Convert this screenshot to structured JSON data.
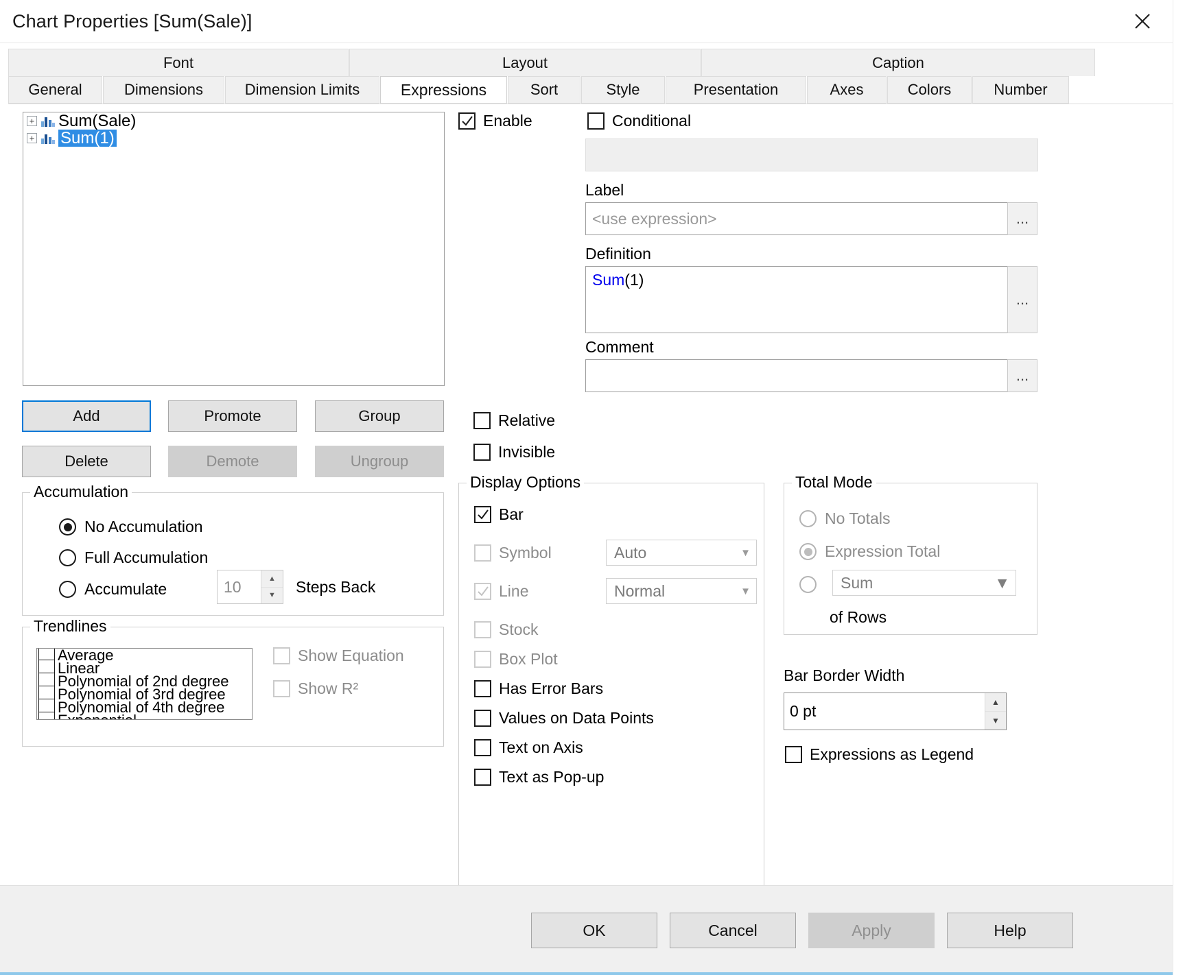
{
  "window": {
    "title": "Chart Properties [Sum(Sale)]",
    "close_icon": "close-icon"
  },
  "tabs": {
    "top_row": [
      {
        "label": "Font"
      },
      {
        "label": "Layout"
      },
      {
        "label": "Caption"
      }
    ],
    "bottom_row": [
      {
        "label": "General",
        "active": false
      },
      {
        "label": "Dimensions",
        "active": false
      },
      {
        "label": "Dimension Limits",
        "active": false
      },
      {
        "label": "Expressions",
        "active": true
      },
      {
        "label": "Sort",
        "active": false
      },
      {
        "label": "Style",
        "active": false
      },
      {
        "label": "Presentation",
        "active": false
      },
      {
        "label": "Axes",
        "active": false
      },
      {
        "label": "Colors",
        "active": false
      },
      {
        "label": "Number",
        "active": false
      }
    ]
  },
  "expression_tree": {
    "items": [
      {
        "label": "Sum(Sale)",
        "selected": false,
        "expander": "+"
      },
      {
        "label": "Sum(1)",
        "selected": true,
        "expander": "+"
      }
    ]
  },
  "list_buttons": {
    "add": "Add",
    "promote": "Promote",
    "group": "Group",
    "delete": "Delete",
    "demote": "Demote",
    "ungroup": "Ungroup"
  },
  "accumulation": {
    "legend": "Accumulation",
    "no_accumulation": "No Accumulation",
    "full_accumulation": "Full Accumulation",
    "accumulate": "Accumulate",
    "steps_value": "10",
    "steps_label": "Steps Back"
  },
  "trendlines": {
    "legend": "Trendlines",
    "items": [
      "Average",
      "Linear",
      "Polynomial of 2nd degree",
      "Polynomial of 3rd degree",
      "Polynomial of 4th degree",
      "Exponential"
    ],
    "show_equation": "Show Equation",
    "show_r2": "Show R²"
  },
  "expression_panel": {
    "enable": "Enable",
    "conditional": "Conditional",
    "conditional_value": "",
    "label_caption": "Label",
    "label_placeholder": "<use expression>",
    "definition_caption": "Definition",
    "definition_keyword": "Sum",
    "definition_rest": "(1)",
    "comment_caption": "Comment",
    "comment_value": "",
    "ellipsis": "...",
    "relative": "Relative",
    "invisible": "Invisible"
  },
  "display_options": {
    "legend": "Display Options",
    "bar": "Bar",
    "symbol": "Symbol",
    "symbol_select": "Auto",
    "line": "Line",
    "line_select": "Normal",
    "stock": "Stock",
    "box_plot": "Box Plot",
    "has_error_bars": "Has Error Bars",
    "values_on_data_points": "Values on Data Points",
    "text_on_axis": "Text on Axis",
    "text_as_popup": "Text as Pop-up"
  },
  "total_mode": {
    "legend": "Total Mode",
    "no_totals": "No Totals",
    "expression_total": "Expression Total",
    "aggregation": "Sum",
    "of_rows": "of Rows"
  },
  "bar_border": {
    "label": "Bar Border Width",
    "value": "0 pt"
  },
  "expressions_as_legend": "Expressions as Legend",
  "footer": {
    "ok": "OK",
    "cancel": "Cancel",
    "apply": "Apply",
    "help": "Help"
  },
  "colors": {
    "selection_blue": "#2f8de4",
    "focus_blue": "#0078d7",
    "keyword_blue": "#0000ee",
    "disabled_gray": "#8c8c8c"
  }
}
